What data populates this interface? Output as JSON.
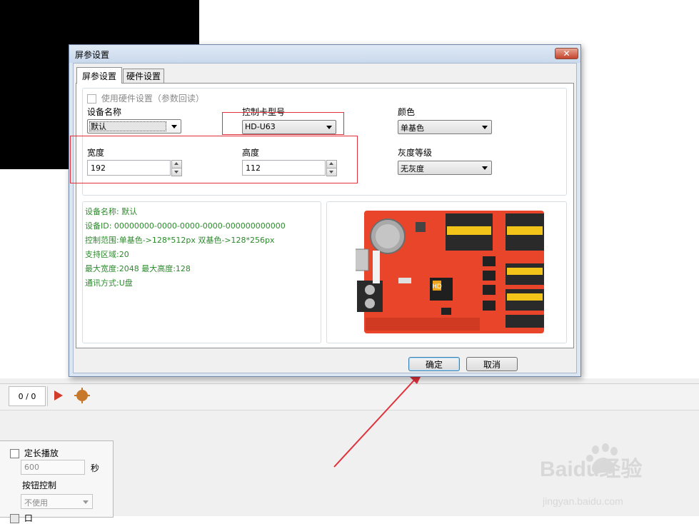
{
  "dialog": {
    "title": "屏参设置",
    "close_glyph": "✕",
    "tabs": [
      {
        "label": "屏参设置",
        "active": true
      },
      {
        "label": "硬件设置",
        "active": false
      }
    ],
    "read_hardware_checkbox": "使用硬件设置（参数回读）",
    "device_name": {
      "label": "设备名称",
      "value": "默认"
    },
    "card_model": {
      "label": "控制卡型号",
      "value": "HD-U63"
    },
    "color": {
      "label": "颜色",
      "value": "单基色"
    },
    "width": {
      "label": "宽度",
      "value": "192"
    },
    "height": {
      "label": "高度",
      "value": "112"
    },
    "gray_level": {
      "label": "灰度等级",
      "value": "无灰度"
    },
    "info": [
      "设备名称: 默认",
      "设备ID:  00000000-0000-0000-0000-000000000000",
      "控制范围:单基色->128*512px  双基色->128*256px",
      "支持区域:20",
      "最大宽度:2048 最大高度:128",
      "通讯方式:U盘"
    ],
    "ok_label": "确定",
    "cancel_label": "取消"
  },
  "board_image": {
    "chip_label": "HD",
    "side_text": "HD-U63"
  },
  "player": {
    "counter": "0 / 0"
  },
  "side_panel": {
    "fixed_length_label": "定长播放",
    "duration_value": "600",
    "seconds_unit": "秒",
    "button_control_label": "按钮控制",
    "button_control_value": "不使用",
    "cut_label": "口"
  },
  "watermark": {
    "brand": "Baidu经验",
    "url": "jingyan.baidu.com"
  },
  "colors": {
    "annotation_red": "#e0303a",
    "info_green": "#2a8a2a",
    "board_red": "#e8452a"
  }
}
